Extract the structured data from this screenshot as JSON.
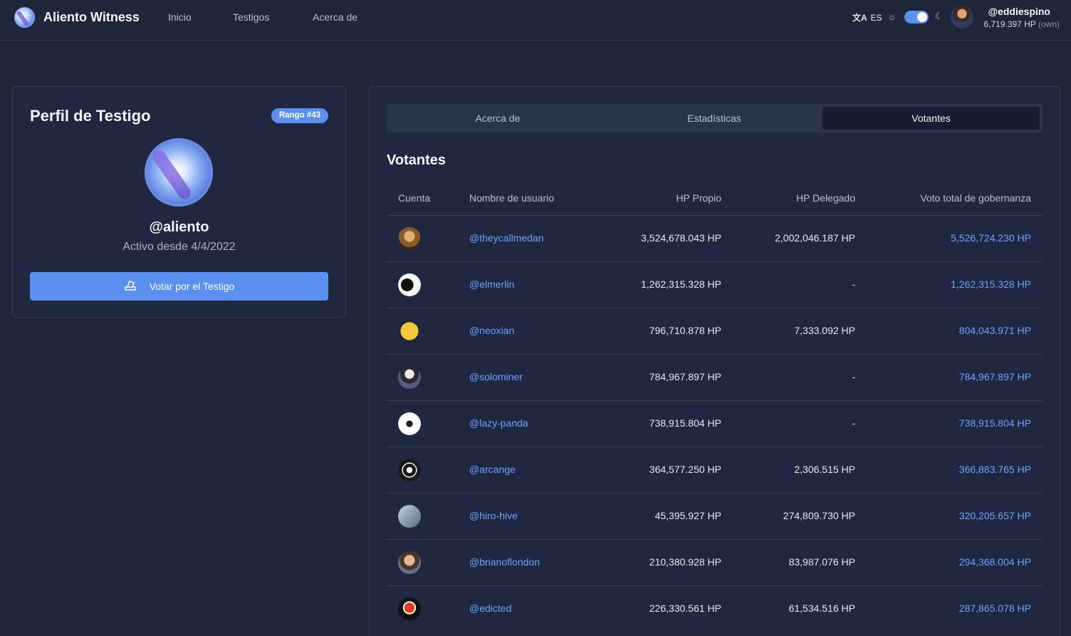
{
  "header": {
    "brand": "Aliento Witness",
    "nav": [
      "Inicio",
      "Testigos",
      "Acerca de"
    ],
    "language": "ES",
    "user": {
      "handle": "@eddiespino",
      "hp": "6,719.397 HP",
      "hp_note": "(own)"
    }
  },
  "profile": {
    "title": "Perfil de Testigo",
    "rank": "Rango #43",
    "handle": "@aliento",
    "since": "Activo desde 4/4/2022",
    "vote_button": "Votar por el Testigo"
  },
  "tabs": [
    "Acerca de",
    "Estadísticas",
    "Votantes"
  ],
  "active_tab": "Votantes",
  "voters": {
    "title": "Votantes",
    "columns": [
      "Cuenta",
      "Nombre de usuario",
      "HP Propio",
      "HP Delegado",
      "Voto total de gobernanza"
    ],
    "rows": [
      {
        "user": "@theycallmedan",
        "own": "3,524,678.043 HP",
        "delegated": "2,002,046.187 HP",
        "total": "5,526,724.230 HP"
      },
      {
        "user": "@elmerlin",
        "own": "1,262,315.328 HP",
        "delegated": "-",
        "total": "1,262,315.328 HP"
      },
      {
        "user": "@neoxian",
        "own": "796,710.878 HP",
        "delegated": "7,333.092 HP",
        "total": "804,043.971 HP"
      },
      {
        "user": "@solominer",
        "own": "784,967.897 HP",
        "delegated": "-",
        "total": "784,967.897 HP"
      },
      {
        "user": "@lazy-panda",
        "own": "738,915.804 HP",
        "delegated": "-",
        "total": "738,915.804 HP"
      },
      {
        "user": "@arcange",
        "own": "364,577.250 HP",
        "delegated": "2,306.515 HP",
        "total": "366,883.765 HP"
      },
      {
        "user": "@hiro-hive",
        "own": "45,395.927 HP",
        "delegated": "274,809.730 HP",
        "total": "320,205.657 HP"
      },
      {
        "user": "@brianoflondon",
        "own": "210,380.928 HP",
        "delegated": "83,987.076 HP",
        "total": "294,368.004 HP"
      },
      {
        "user": "@edicted",
        "own": "226,330.561 HP",
        "delegated": "61,534.516 HP",
        "total": "287,865.078 HP"
      }
    ]
  }
}
